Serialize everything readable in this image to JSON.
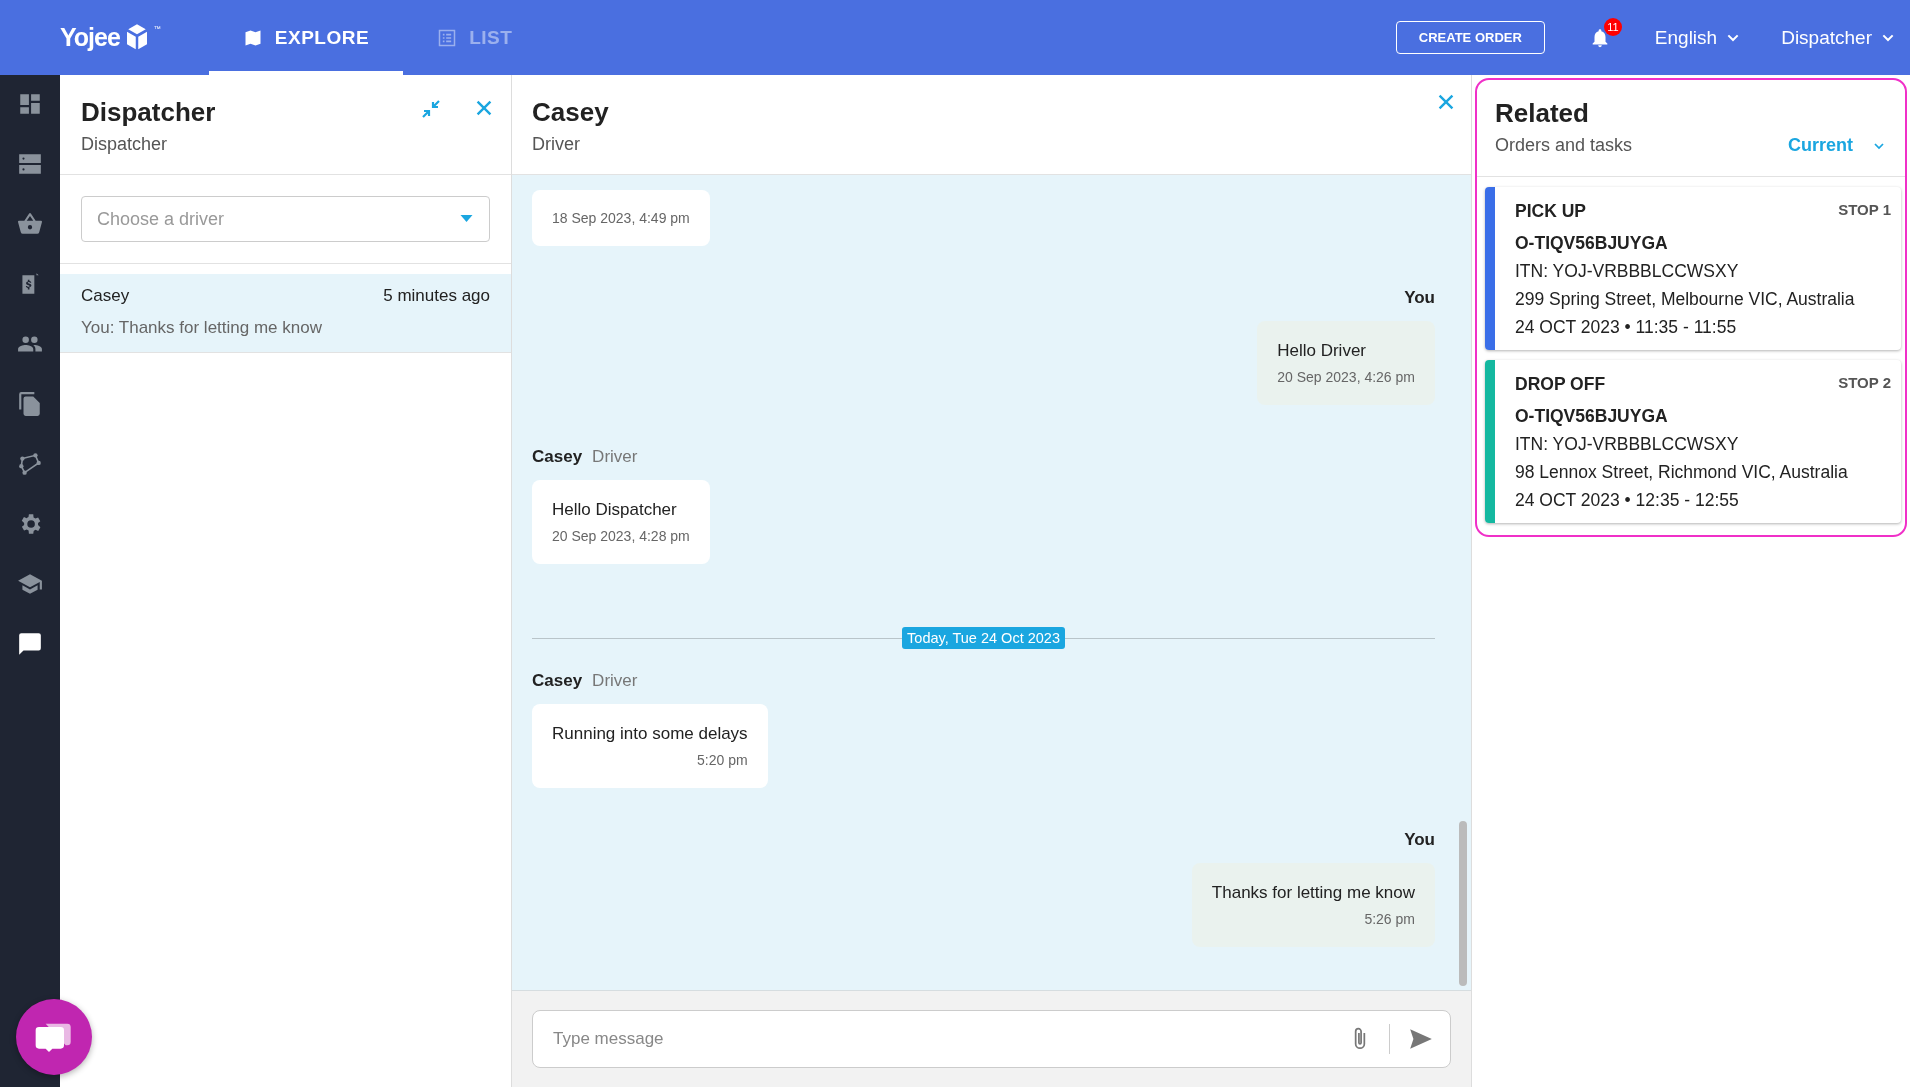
{
  "topbar": {
    "logo": "Yojee",
    "trademark": "™",
    "tabs": [
      {
        "label": "EXPLORE",
        "kind": "map",
        "selected": true
      },
      {
        "label": "LIST",
        "kind": "list",
        "selected": false
      }
    ],
    "create_button": "CREATE ORDER",
    "notifications": "11",
    "language": "English",
    "user": "Dispatcher"
  },
  "nav": [
    {
      "kind": "dashboard",
      "selected": false
    },
    {
      "kind": "servers",
      "selected": false
    },
    {
      "kind": "basket",
      "selected": false
    },
    {
      "kind": "invoice",
      "selected": false
    },
    {
      "kind": "people",
      "selected": false
    },
    {
      "kind": "documents",
      "selected": false
    },
    {
      "kind": "polygon",
      "selected": false
    },
    {
      "kind": "settings",
      "selected": false
    },
    {
      "kind": "school",
      "selected": false
    },
    {
      "kind": "chat",
      "selected": true
    }
  ],
  "conversations": {
    "title": "Dispatcher",
    "subtitle": "Dispatcher",
    "driver_select": {
      "placeholder": "Choose a driver"
    },
    "items": [
      {
        "name": "Casey",
        "time": "5 minutes ago",
        "preview": "You: Thanks for letting me know",
        "selected": true
      }
    ]
  },
  "chat": {
    "title": "Casey",
    "subtitle": "Driver",
    "messages": [
      {
        "kind": "incoming",
        "time": "18 Sep 2023, 4:49 pm"
      },
      {
        "kind": "outgoing",
        "sender": "You",
        "text": "Hello Driver",
        "time": "20 Sep 2023, 4:26 pm"
      },
      {
        "kind": "incoming",
        "sender": "Casey",
        "role": "Driver",
        "text": "Hello Dispatcher",
        "time": "20 Sep 2023, 4:28 pm"
      },
      {
        "kind": "divider",
        "text": "Today, Tue 24 Oct 2023"
      },
      {
        "kind": "incoming",
        "sender": "Casey",
        "role": "Driver",
        "text": "Running into some delays",
        "time": "5:20 pm"
      },
      {
        "kind": "outgoing",
        "sender": "You",
        "text": "Thanks for letting me know",
        "time": "5:26 pm"
      }
    ],
    "composer": {
      "placeholder": "Type message"
    }
  },
  "related": {
    "title": "Related",
    "subtitle": "Orders and tasks",
    "filter": "Current",
    "stops": [
      {
        "type": "PICK UP",
        "stop": "STOP 1",
        "color": "#3a6ee8",
        "order": "O-TIQV56BJUYGA",
        "itn": "ITN: YOJ-VRBBBLCCWSXY",
        "address": "299 Spring Street, Melbourne VIC, Australia",
        "time": "24 OCT 2023 • 11:35 - 11:55"
      },
      {
        "type": "DROP OFF",
        "stop": "STOP 2",
        "color": "#14b8a0",
        "order": "O-TIQV56BJUYGA",
        "itn": "ITN: YOJ-VRBBBLCCWSXY",
        "address": "98 Lennox Street, Richmond VIC, Australia",
        "time": "24 OCT 2023 • 12:35 - 12:55"
      }
    ]
  }
}
